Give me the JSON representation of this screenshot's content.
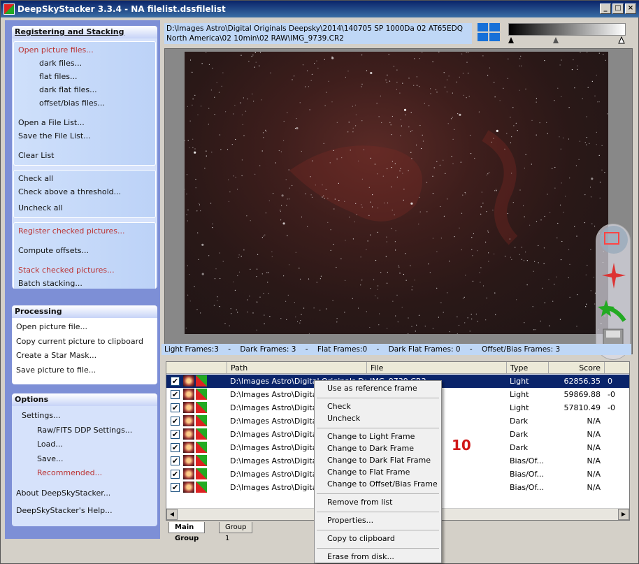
{
  "window": {
    "title": "DeepSkyStacker 3.3.4 - NA filelist.dssfilelist"
  },
  "sidebar": {
    "registering": {
      "header": "Registering and Stacking",
      "group1": [
        "Open picture files...",
        "dark files...",
        "flat files...",
        "dark flat files...",
        "offset/bias files...",
        "Open a File List...",
        "Save the File List...",
        "Clear List"
      ],
      "group2": [
        "Check all",
        "Check above a threshold...",
        "Uncheck all"
      ],
      "group3": [
        "Register checked pictures...",
        "Compute offsets...",
        "Stack checked pictures...",
        "Batch stacking..."
      ]
    },
    "processing": {
      "header": "Processing",
      "items": [
        "Open picture file...",
        "Copy current picture to clipboard",
        "Create a Star Mask...",
        "Save picture to file..."
      ]
    },
    "options": {
      "header": "Options",
      "items": [
        "Settings...",
        "Raw/FITS DDP Settings...",
        "Load...",
        "Save...",
        "Recommended...",
        "About DeepSkyStacker...",
        "DeepSkyStacker's Help..."
      ]
    }
  },
  "main": {
    "path_text": "D:\\Images Astro\\Digital Originals Deepsky\\2014\\140705 SP 1000Da 02 AT65EDQ North America\\02 10min\\02 RAW\\IMG_9739.CR2",
    "counts": "Light Frames:3    -    Dark Frames: 3    -    Flat Frames:0    -    Dark Flat Frames: 0    -    Offset/Bias Frames: 3"
  },
  "list": {
    "headers": [
      "Path",
      "File",
      "Type",
      "Score"
    ],
    "rows": [
      {
        "path": "D:\\Images Astro\\Digital Originals De...",
        "file": "IMG_9739.CR2",
        "type": "Light",
        "score": "62856.35",
        "extra": "0"
      },
      {
        "path": "D:\\Images Astro\\Digital O",
        "file": "",
        "type": "Light",
        "score": "59869.88",
        "extra": "-0"
      },
      {
        "path": "D:\\Images Astro\\Digital O",
        "file": "",
        "type": "Light",
        "score": "57810.49",
        "extra": "-0"
      },
      {
        "path": "D:\\Images Astro\\Digital O",
        "file": "",
        "type": "Dark",
        "score": "N/A",
        "extra": ""
      },
      {
        "path": "D:\\Images Astro\\Digital O",
        "file": "",
        "type": "Dark",
        "score": "N/A",
        "extra": ""
      },
      {
        "path": "D:\\Images Astro\\Digital O",
        "file": "",
        "type": "Dark",
        "score": "N/A",
        "extra": ""
      },
      {
        "path": "D:\\Images Astro\\Digital O",
        "file": "",
        "type": "Bias/Of...",
        "score": "N/A",
        "extra": ""
      },
      {
        "path": "D:\\Images Astro\\Digital O",
        "file": "",
        "type": "Bias/Of...",
        "score": "N/A",
        "extra": ""
      },
      {
        "path": "D:\\Images Astro\\Digital O",
        "file": "",
        "type": "Bias/Of...",
        "score": "N/A",
        "extra": ""
      }
    ]
  },
  "tabs": [
    "Main Group",
    "Group 1"
  ],
  "context_menu": [
    "Use as reference frame",
    "Check",
    "Uncheck",
    "Change to Light Frame",
    "Change to Dark Frame",
    "Change to Dark Flat Frame",
    "Change to Flat Frame",
    "Change to Offset/Bias Frame",
    "Remove from list",
    "Properties...",
    "Copy to clipboard",
    "Erase from disk..."
  ],
  "annotation": "10"
}
